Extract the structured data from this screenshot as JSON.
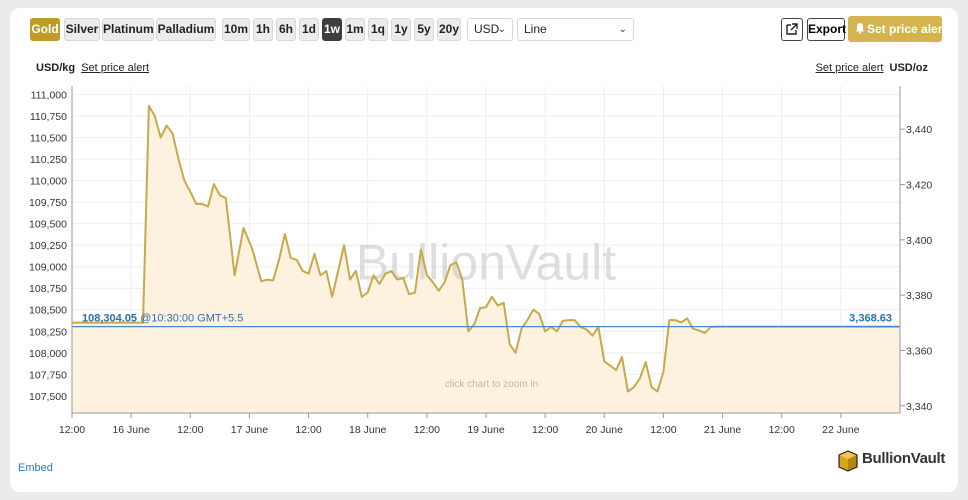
{
  "toolbar": {
    "metals": [
      {
        "label": "Gold",
        "active": true
      },
      {
        "label": "Silver",
        "active": false
      },
      {
        "label": "Platinum",
        "active": false
      },
      {
        "label": "Palladium",
        "active": false
      }
    ],
    "ranges": [
      {
        "label": "10m",
        "active": false
      },
      {
        "label": "1h",
        "active": false
      },
      {
        "label": "6h",
        "active": false
      },
      {
        "label": "1d",
        "active": false
      },
      {
        "label": "1w",
        "active": true
      },
      {
        "label": "1m",
        "active": false
      },
      {
        "label": "1q",
        "active": false
      },
      {
        "label": "1y",
        "active": false
      },
      {
        "label": "5y",
        "active": false
      },
      {
        "label": "20y",
        "active": false
      }
    ],
    "currency": "USD",
    "chart_style": "Line",
    "export_label": "Export",
    "alert_label": "Set price alert"
  },
  "units": {
    "left_unit": "USD/kg",
    "left_link": "Set price alert",
    "right_unit": "USD/oz",
    "right_link": "Set price alert"
  },
  "embed_label": "Embed",
  "brand": "BullionVault",
  "colors": {
    "line": "#c6a94c",
    "fill": "#fdf1dc",
    "current_line": "#4a86c8",
    "gold_button": "#bd9c2a",
    "alert_button": "#d5b44f"
  },
  "chart_data": {
    "type": "line",
    "watermark": "BullionVault",
    "hint": "click chart to zoom in",
    "x_tick_labels": [
      "12:00",
      "16 June",
      "12:00",
      "17 June",
      "12:00",
      "18 June",
      "12:00",
      "19 June",
      "12:00",
      "20 June",
      "12:00",
      "21 June",
      "12:00",
      "22 June"
    ],
    "x_range": [
      0,
      14
    ],
    "y_left": {
      "ticks": [
        107500,
        107750,
        108000,
        108250,
        108500,
        108750,
        109000,
        109250,
        109500,
        109750,
        110000,
        110250,
        110500,
        110750,
        111000
      ],
      "tick_labels": [
        "107,500",
        "107,750",
        "108,000",
        "108,250",
        "108,500",
        "108,750",
        "109,000",
        "109,250",
        "109,500",
        "109,750",
        "110,000",
        "110,250",
        "110,500",
        "110,750",
        "111,000"
      ],
      "range": [
        107300,
        111100
      ]
    },
    "y_right": {
      "ticks": [
        3340,
        3360,
        3380,
        3400,
        3420,
        3440
      ],
      "tick_labels": [
        "3,340",
        "3,360",
        "3,380",
        "3,400",
        "3,420",
        "3,440"
      ]
    },
    "current": {
      "value_kg": 108304.05,
      "label_kg": "108,304.05",
      "time_label": "@10:30:00 GMT+5.5",
      "label_oz": "3,368.63"
    },
    "series": [
      {
        "x": [
          0,
          1.2,
          1.3,
          1.4,
          1.5,
          1.6,
          1.7,
          1.8,
          1.9,
          2.0,
          2.1,
          2.2,
          2.3,
          2.4,
          2.5,
          2.6,
          2.75,
          2.9,
          3.05,
          3.2,
          3.3,
          3.4,
          3.5,
          3.6,
          3.7,
          3.8,
          3.9,
          4.0,
          4.1,
          4.2,
          4.3,
          4.4,
          4.5,
          4.6,
          4.7,
          4.8,
          4.9,
          5.0,
          5.1,
          5.2,
          5.3,
          5.4,
          5.5,
          5.6,
          5.7,
          5.8,
          5.9,
          6.0,
          6.1,
          6.2,
          6.3,
          6.4,
          6.5,
          6.6,
          6.7,
          6.8,
          6.9,
          7.0,
          7.1,
          7.2,
          7.3,
          7.4,
          7.5,
          7.6,
          7.7,
          7.8,
          7.9,
          8.0,
          8.1,
          8.2,
          8.3,
          8.4,
          8.5,
          8.6,
          8.7,
          8.8,
          8.9,
          9.0,
          9.1,
          9.2,
          9.3,
          9.4,
          9.5,
          9.6,
          9.7,
          9.8,
          9.9,
          10.0,
          10.1,
          10.2,
          10.3,
          10.4,
          10.5,
          10.6,
          10.7,
          10.8,
          10.9,
          11.0,
          11.1,
          11.2,
          11.3,
          11.4,
          11.5,
          11.6,
          11.7,
          11.8,
          11.9,
          12.0,
          12.5,
          13.0,
          13.5,
          14.0
        ],
        "values": [
          108350,
          108350,
          110870,
          110750,
          110500,
          110640,
          110550,
          110250,
          110000,
          109870,
          109730,
          109730,
          109700,
          109960,
          109830,
          109800,
          108900,
          109450,
          109200,
          108830,
          108850,
          108840,
          109080,
          109380,
          109100,
          109080,
          108950,
          108920,
          109150,
          108900,
          108950,
          108650,
          108950,
          109250,
          108850,
          108950,
          108650,
          108700,
          108900,
          108800,
          108920,
          108950,
          108850,
          108870,
          108680,
          108700,
          109200,
          108900,
          108820,
          108720,
          108820,
          109020,
          109050,
          108850,
          108250,
          108330,
          108520,
          108530,
          108650,
          108550,
          108580,
          108100,
          108000,
          108280,
          108380,
          108500,
          108450,
          108250,
          108300,
          108250,
          108370,
          108380,
          108380,
          108300,
          108270,
          108200,
          108300,
          107900,
          107850,
          107800,
          107950,
          107550,
          107600,
          107700,
          107890,
          107600,
          107550,
          107780,
          108380,
          108380,
          108350,
          108400,
          108280,
          108260,
          108230,
          108300,
          108304,
          108304,
          108304,
          108304,
          108304,
          108304,
          108304,
          108304,
          108304,
          108304,
          108304,
          108304,
          108304,
          108304,
          108304,
          108304
        ]
      }
    ]
  }
}
